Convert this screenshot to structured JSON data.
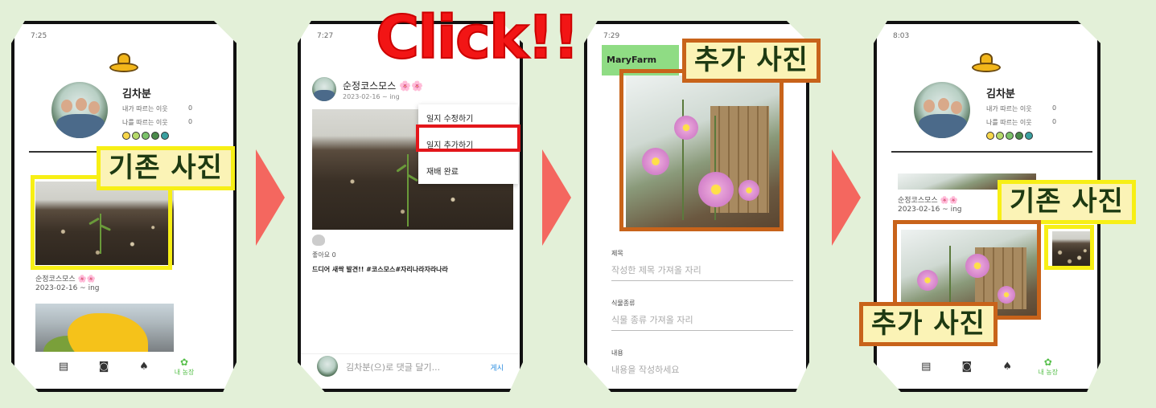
{
  "callouts": {
    "click": "Click!!",
    "existing_photo": "기존 사진",
    "added_photo": "추가 사진"
  },
  "screen1": {
    "status_time": "7:25",
    "user_name": "김차분",
    "following_label": "내가 따르는 이웃",
    "following_count": "0",
    "followers_label": "나를 따르는 이웃",
    "followers_count": "0",
    "post_title": "순정코스모스 🌸🌸",
    "post_date": "2023-02-16 ~ ing",
    "nav": {
      "my_farm": "내 농장"
    }
  },
  "screen2": {
    "status_time": "7:27",
    "post_title": "순정코스모스 🌸🌸",
    "post_date": "2023-02-16 ~ ing",
    "menu": [
      "일지 수정하기",
      "일지 추가하기",
      "재배 완료"
    ],
    "like_label": "좋아요 0",
    "body": "드디어 새싹 발견!! #코스모스#자리나라자라나라",
    "comment_placeholder": "김차분(으)로 댓글 달기...",
    "comment_send": "게시"
  },
  "screen3": {
    "status_time": "7:29",
    "app_title": "MaryFarm",
    "fields": [
      {
        "label": "제목",
        "placeholder": "작성한 제목 가져올 자리"
      },
      {
        "label": "식물종류",
        "placeholder": "식물 종류 가져올 자리"
      },
      {
        "label": "내용",
        "placeholder": "내용을 작성하세요"
      }
    ]
  },
  "screen4": {
    "status_time": "8:03",
    "user_name": "김차분",
    "following_label": "내가 따르는 이웃",
    "following_count": "0",
    "followers_label": "나를 따르는 이웃",
    "followers_count": "0",
    "post_title": "순정코스모스 🌸🌸",
    "post_date": "2023-02-16 ~ ing",
    "nav": {
      "my_farm": "내 농장"
    }
  },
  "colors": {
    "background": "#e3f0d8",
    "arrow": "#f4675f",
    "highlight_yellow": "#f7ef15",
    "highlight_orange": "#c8631a",
    "click_red": "#f21515",
    "appbar_green": "#8fdc84"
  }
}
